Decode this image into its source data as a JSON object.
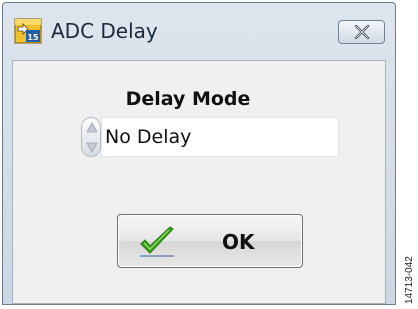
{
  "window": {
    "title": "ADC Delay",
    "app_icon": "labview-vi-icon",
    "close_icon": "close-icon"
  },
  "delay_mode": {
    "label": "Delay Mode",
    "selected_value": "No Delay"
  },
  "ok_button": {
    "label": "OK",
    "icon": "checkmark-icon"
  },
  "figure_id": "14713-042",
  "colors": {
    "titlebar": "#dfe5ee",
    "client_bg": "#f0f0f0",
    "check_green": "#3aa31a"
  }
}
